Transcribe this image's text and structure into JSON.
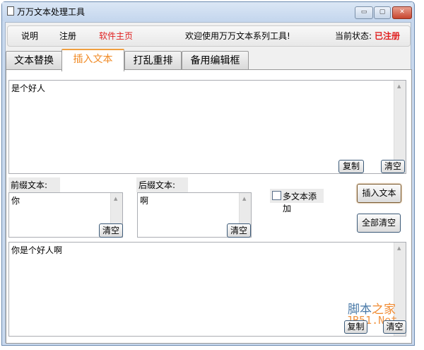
{
  "window": {
    "title": "万万文本处理工具",
    "minimize": "▭",
    "maximize": "▢",
    "close": "✕"
  },
  "menu": {
    "help": "说明",
    "register": "注册",
    "homepage": "软件主页",
    "welcome": "欢迎使用万万文本系列工具!",
    "status_label": "当前状态:",
    "status_value": "已注册"
  },
  "tabs": [
    {
      "label": "文本替换"
    },
    {
      "label": "插入文本"
    },
    {
      "label": "打乱重排"
    },
    {
      "label": "备用编辑框"
    }
  ],
  "main": {
    "source_text": "是个好人",
    "copy": "复制",
    "clear": "清空",
    "prefix_label": "前缀文本:",
    "prefix_value": "你",
    "suffix_label": "后缀文本:",
    "suffix_value": "啊",
    "multi_checkbox": "多文本添加",
    "insert_button": "插入文本",
    "clear_all_button": "全部清空",
    "result_text": "你是个好人啊"
  },
  "watermark": {
    "line1a": "脚本",
    "line1b": "之家",
    "line2": "JB51.Net"
  }
}
